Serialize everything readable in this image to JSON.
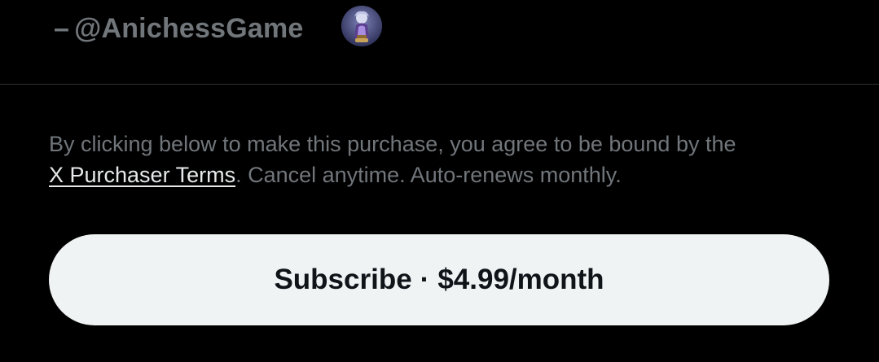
{
  "header": {
    "dash": "–",
    "handle": "@AnichessGame",
    "avatar_icon": "chess-queen-avatar-icon"
  },
  "terms": {
    "text_before": "By clicking below to make this purchase, you agree to be bound by the",
    "link_label": "X Purchaser Terms",
    "text_after": ". Cancel anytime. Auto-renews monthly."
  },
  "subscribe": {
    "action": "Subscribe",
    "separator": "·",
    "price": "$4.99/month"
  },
  "colors": {
    "background": "#000000",
    "muted_text": "#71767b",
    "link_text": "#e7e9ea",
    "button_bg": "#eff3f4",
    "button_text": "#0f1419",
    "divider": "#2f3336"
  }
}
